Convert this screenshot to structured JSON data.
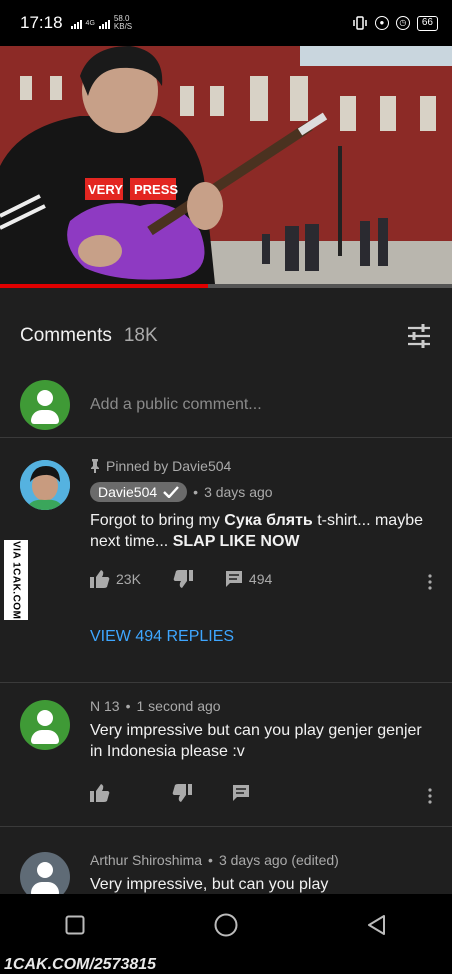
{
  "status_bar": {
    "time": "17:18",
    "network": "4G",
    "speed_value": "58.0",
    "speed_unit": "KB/S",
    "battery": "66"
  },
  "video": {
    "shirt_text_1": "VERY",
    "shirt_text_2": "PRESS",
    "progress_fraction": 0.46
  },
  "comments_header": {
    "title": "Comments",
    "count": "18K"
  },
  "add_comment": {
    "placeholder": "Add a public comment..."
  },
  "comments": [
    {
      "pinned_label": "Pinned by Davie504",
      "author": "Davie504",
      "time": "3 days ago",
      "text_part1": "Forgot to bring my ",
      "text_bold1": "Сука блять",
      "text_part2": " t-shirt... maybe next time... ",
      "text_bold2": "SLAP LIKE NOW",
      "likes": "23K",
      "replies_count": "494",
      "view_replies": "VIEW 494 REPLIES"
    },
    {
      "author": "N 13",
      "time": "1 second ago",
      "text": "Very impressive but can you play genjer genjer in Indonesia please :v"
    },
    {
      "author": "Arthur Shiroshima",
      "time": "3 days ago (edited)",
      "text": "Very impressive, but can you play"
    }
  ],
  "watermarks": {
    "side": "VIA 1CAK.COM",
    "bottom": "1CAK.COM/2573815"
  },
  "colors": {
    "background": "#1f1f1f",
    "link": "#3ea6ff",
    "avatar_green": "#3f9a36",
    "progress": "#e00000"
  }
}
